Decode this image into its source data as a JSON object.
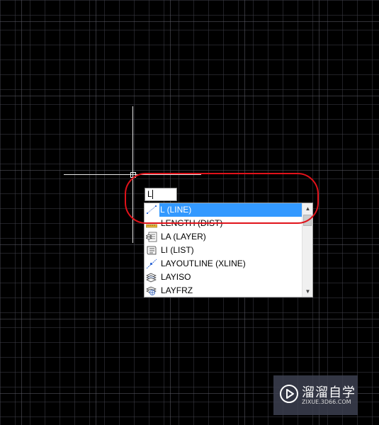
{
  "command_input": {
    "value": "L"
  },
  "autocomplete": {
    "items": [
      {
        "label": "L (LINE)",
        "icon": "line-icon",
        "selected": true
      },
      {
        "label": "LENGTH (DIST)",
        "icon": "measure-distance-icon",
        "selected": false
      },
      {
        "label": "LA (LAYER)",
        "icon": "layer-properties-icon",
        "selected": false
      },
      {
        "label": "LI (LIST)",
        "icon": "list-icon",
        "selected": false
      },
      {
        "label": "LAYOUTLINE (XLINE)",
        "icon": "construction-line-icon",
        "selected": false
      },
      {
        "label": "LAYISO",
        "icon": "layer-isolate-icon",
        "selected": false
      },
      {
        "label": "LAYFRZ",
        "icon": "layer-freeze-icon",
        "selected": false
      }
    ],
    "scroll_up": "▲",
    "scroll_down": "▼"
  },
  "watermark": {
    "title": "溜溜自学",
    "url": "ZIXUE.3D66.COM"
  },
  "colors": {
    "background": "#000000",
    "crosshair": "#e6e6e6",
    "selection": "#3399ff",
    "highlight_annotation": "#e0121a"
  }
}
